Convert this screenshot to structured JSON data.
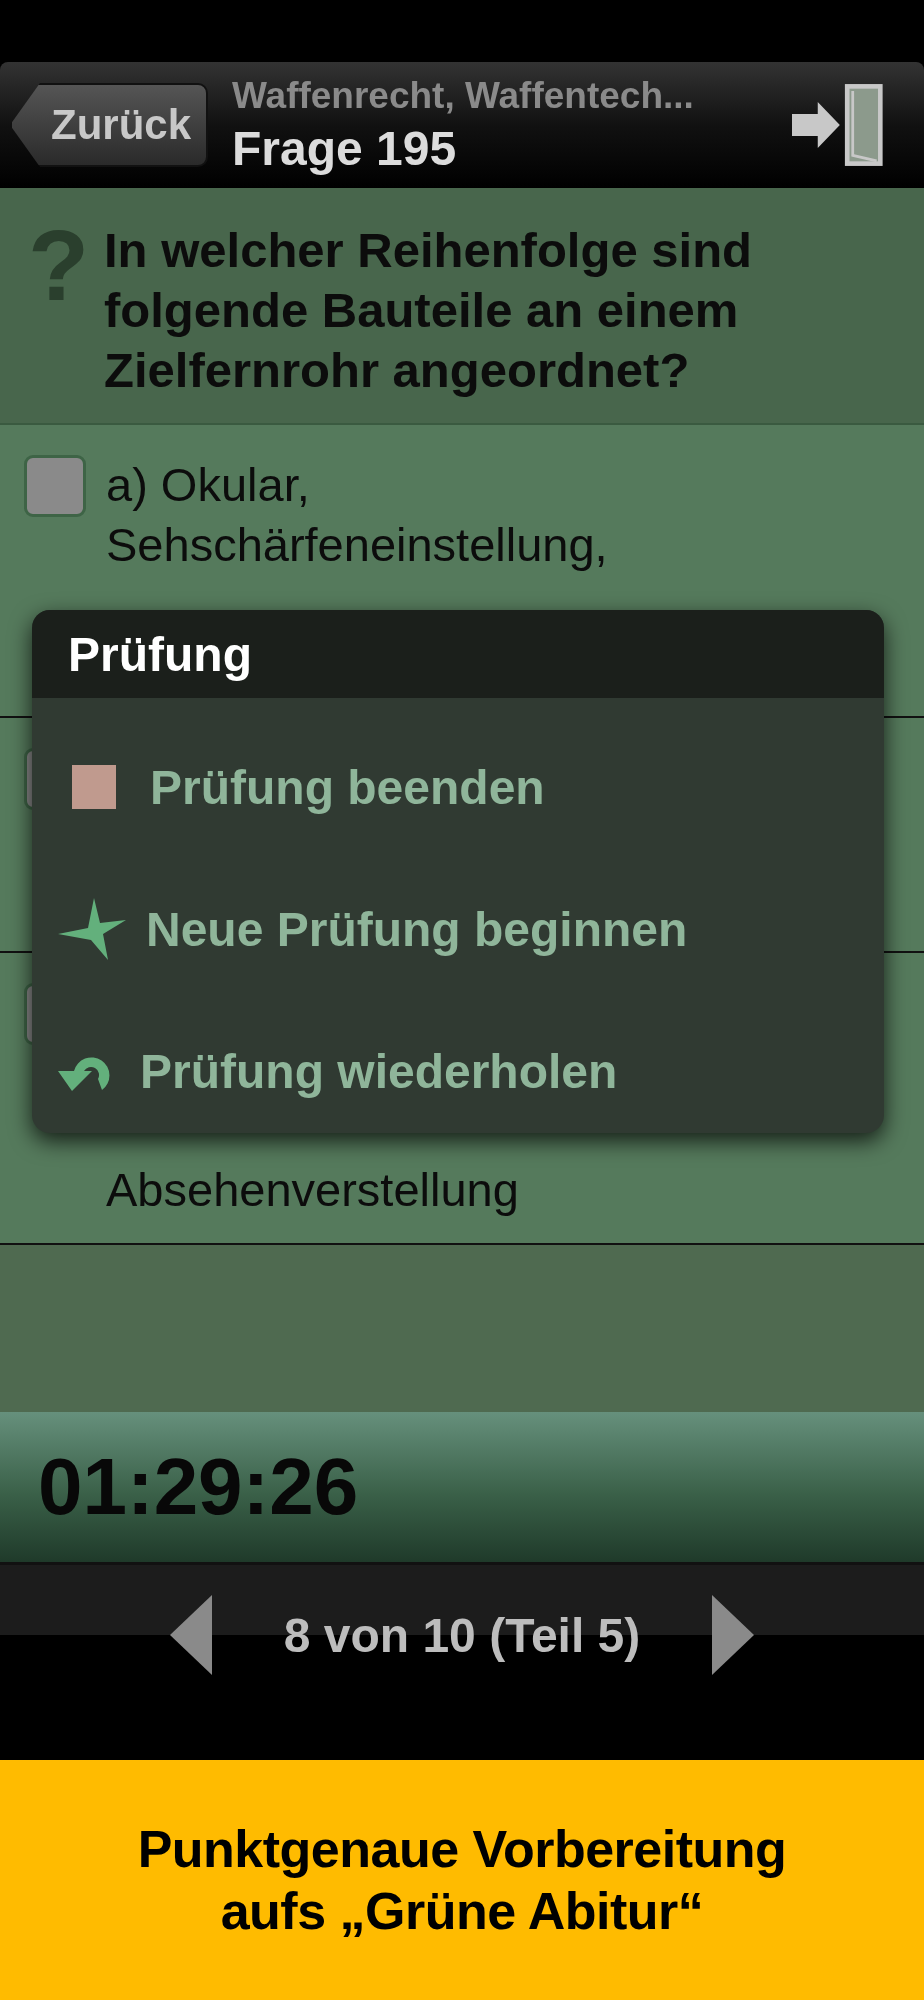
{
  "nav": {
    "back": "Zurück",
    "subtitle": "Waffenrecht, Waffentech...",
    "title": "Frage 195"
  },
  "question": {
    "marker": "?",
    "text": "In welcher Reihenfolge sind folgende Bauteile an einem Zielfernrohr angeordnet?"
  },
  "options": [
    {
      "text": "a) Okular,\nSehschärfeneinstellung,",
      "checked": false
    },
    {
      "checked": false
    },
    {
      "text": "Absehenverstellung",
      "checked": false
    }
  ],
  "menu": {
    "title": "Prüfung",
    "items": [
      {
        "kind": "stop",
        "label": "Prüfung beenden"
      },
      {
        "kind": "new",
        "label": "Neue Prüfung beginnen"
      },
      {
        "kind": "repeat",
        "label": "Prüfung wiederholen"
      }
    ]
  },
  "timer": "01:29:26",
  "pager": "8 von 10 (Teil 5)",
  "banner": "Punktgenaue Vorbereitung\naufs „Grüne Abitur“"
}
